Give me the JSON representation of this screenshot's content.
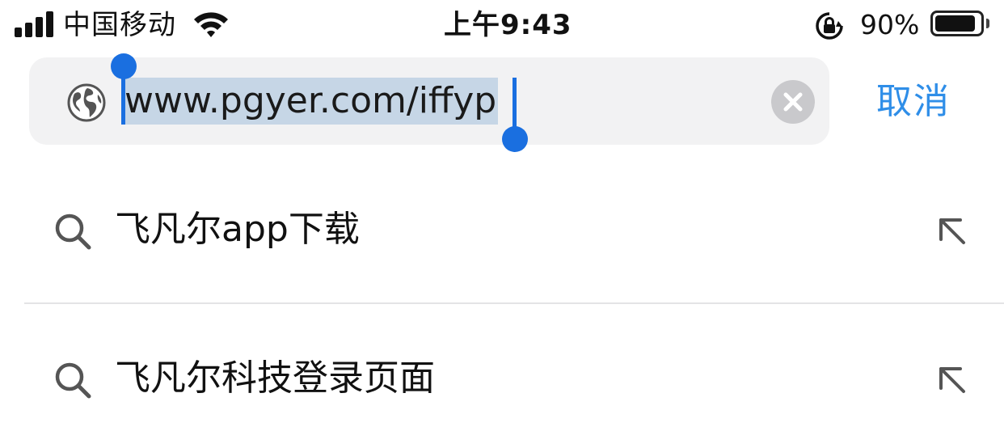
{
  "status_bar": {
    "carrier": "中国移动",
    "time": "上午9:43",
    "battery_percent_text": "90%",
    "battery_level": 0.9,
    "signal_bars": 4,
    "icons": [
      "signal-icon",
      "wifi-icon",
      "rotation-lock-icon",
      "battery-icon"
    ]
  },
  "address_bar": {
    "url": "www.pgyer.com/iffyp",
    "url_selected": true,
    "cancel_label": "取消",
    "icons": [
      "globe-icon",
      "clear-icon"
    ]
  },
  "suggestions": [
    {
      "text": "飞凡尔app下载",
      "icon": "search-icon",
      "action_icon": "fill-arrow-icon"
    },
    {
      "text": "飞凡尔科技登录页面",
      "icon": "search-icon",
      "action_icon": "fill-arrow-icon"
    }
  ],
  "colors": {
    "accent": "#2f8ee8",
    "selection_handle": "#1a6fe0",
    "selection_highlight": "#c6d6e6",
    "field_background": "#f2f2f3"
  }
}
